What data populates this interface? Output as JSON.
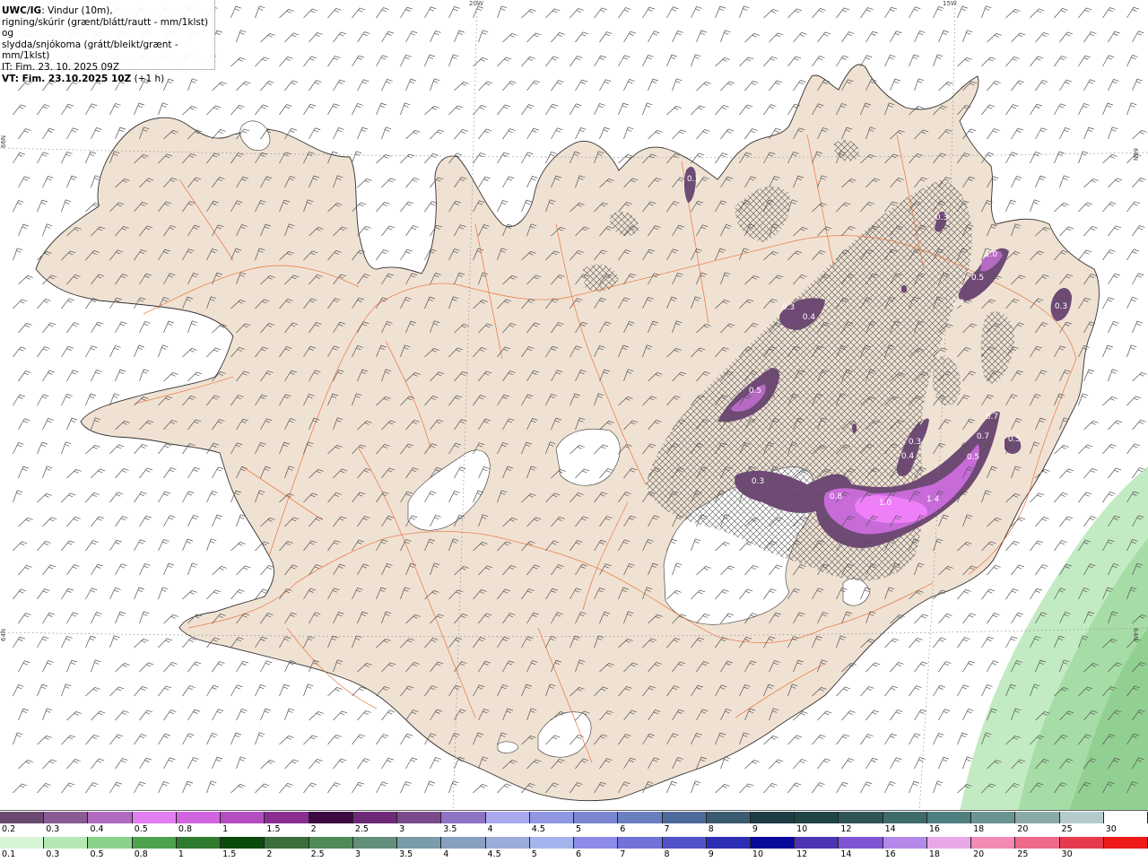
{
  "header": {
    "title_bold": "UWC/IG",
    "title_rest": ": Vindur (10m),",
    "line2": "rigning/skúrir (grænt/blátt/rautt - mm/1klst) og",
    "line3": "slydda/snjókoma (grátt/bleikt/grænt - mm/1klst)",
    "line4": "IT: Fim. 23. 10. 2025 09Z",
    "line5_bold": "VT: Fim. 23.10.2025 10Z",
    "line5_rest": " (+1 h)"
  },
  "graticule": {
    "lon_20": "20W",
    "lon_15": "15W",
    "lat_66_left": "66N",
    "lat_66_right": "66N",
    "lat_64_left": "64N",
    "lat_64_right": "64N"
  },
  "precip_labels": [
    "0.3",
    "0.3",
    "0.4",
    "0.5",
    "1.0",
    "0.5",
    "0.3",
    "0.3",
    "0.3",
    "0.3",
    "0.4",
    "0.7",
    "0.7",
    "0.5",
    "0.3",
    "0.5",
    "0.8",
    "1.0",
    "1.4"
  ],
  "legend_snow": {
    "ticks": [
      "0.2",
      "0.3",
      "0.4",
      "0.5",
      "0.8",
      "1",
      "1.5",
      "2",
      "2.5",
      "3",
      "3.5",
      "4",
      "4.5",
      "5",
      "6",
      "7",
      "8",
      "9",
      "10",
      "12",
      "14",
      "16",
      "18",
      "20",
      "25",
      "30"
    ],
    "colors": [
      "#6a4a6e",
      "#8a5a94",
      "#b06ac0",
      "#e27ef2",
      "#d164e0",
      "#b44ec0",
      "#8a2e92",
      "#3a0a40",
      "#6e2a78",
      "#7a4a8c",
      "#8e72c4",
      "#a8a8ee",
      "#9098e4",
      "#7a86d0",
      "#6a7ec0",
      "#4e6a9a",
      "#3a5a70",
      "#1e3c44",
      "#1e4446",
      "#2e5454",
      "#3e6a6a",
      "#4e7e7e",
      "#6a9494",
      "#8aaaa8",
      "#b6cbcb",
      "#ffffff"
    ]
  },
  "legend_rain": {
    "ticks": [
      "0.1",
      "0.3",
      "0.5",
      "0.8",
      "1",
      "1.5",
      "2",
      "2.5",
      "3",
      "3.5",
      "4",
      "4.5",
      "5",
      "6",
      "7",
      "8",
      "9",
      "10",
      "12",
      "14",
      "16",
      "18",
      "20",
      "25",
      "30"
    ],
    "colors": [
      "#d8f5d8",
      "#b4e8b4",
      "#8ad28a",
      "#4ea24e",
      "#2e7a2e",
      "#0a4a0a",
      "#3a6e3a",
      "#4e8a5a",
      "#628e7a",
      "#7a9ca8",
      "#8aa0c0",
      "#9cacd8",
      "#a4b4ec",
      "#8c8ce8",
      "#7272d8",
      "#5252c8",
      "#2e2eb4",
      "#08089a",
      "#4c34b4",
      "#7e54d4",
      "#b488e8",
      "#e8a8e8",
      "#f28ab4",
      "#ee6a8a",
      "#e83a4e",
      "#ee1a1a"
    ]
  },
  "colors": {
    "land": "#f0e2d3",
    "glacier": "#ffffff",
    "sea": "#ffffff",
    "roads": "#e8703a",
    "coast": "#333333",
    "barb": "#555555"
  }
}
